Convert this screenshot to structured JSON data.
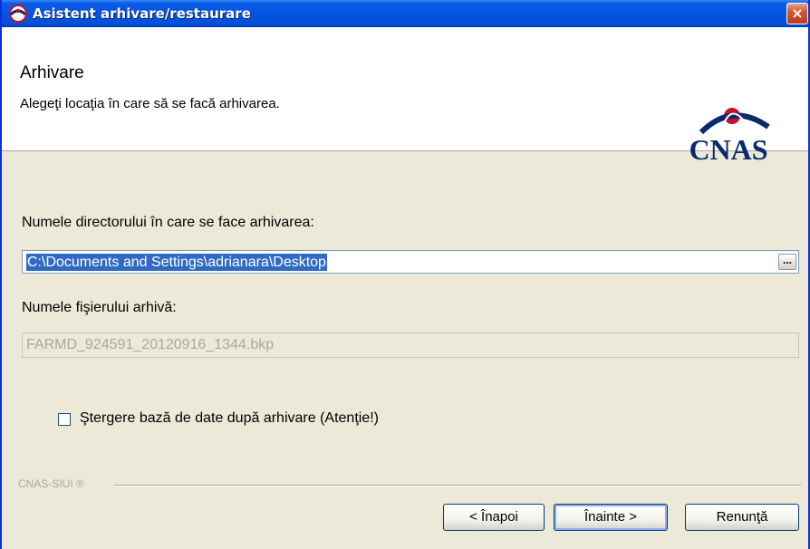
{
  "window": {
    "title": "Asistent arhivare/restaurare",
    "close_glyph": "×"
  },
  "header": {
    "title": "Arhivare",
    "subtitle": "Alegeţi locaţia în care să se facă arhivarea.",
    "logo_text": "CNAS"
  },
  "form": {
    "dir_label": "Numele directorului în care se face arhivarea:",
    "dir_value": "C:\\Documents and Settings\\adrianara\\Desktop",
    "browse_label": "...",
    "file_label": "Numele fişierului arhivă:",
    "file_value": "FARMD_924591_20120916_1344.bkp",
    "delete_checkbox_label": "Ştergere bază de date după arhivare (Atenţie!)",
    "delete_checked": false
  },
  "footer": {
    "brand": "CNAS-SIUI ®",
    "back_label": "< Înapoi",
    "next_label": "Înainte >",
    "cancel_label": "Renunţă"
  },
  "colors": {
    "titlebar": "#0553e1",
    "selection": "#316ac5",
    "logo": "#0a2a6b",
    "logo_accent": "#c8102e"
  }
}
